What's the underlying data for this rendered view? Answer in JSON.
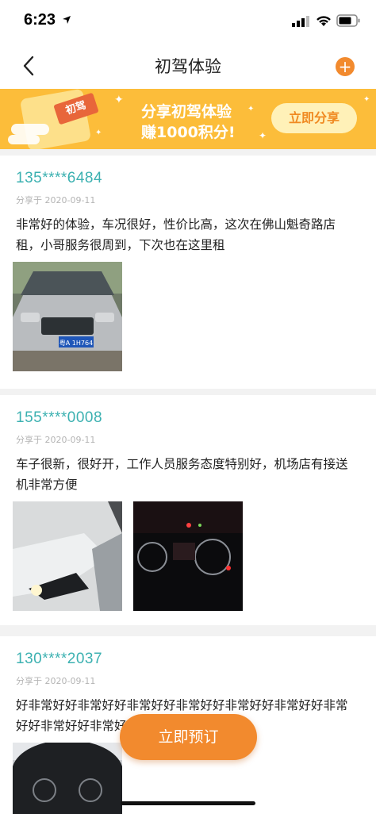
{
  "status": {
    "time": "6:23"
  },
  "nav": {
    "title": "初驾体验",
    "back_icon": "chevron-left-icon",
    "add_icon": "plus-circle-icon"
  },
  "banner": {
    "badge": "初驾",
    "line1": "分享初驾体验",
    "line2": "赚1000积分!",
    "button": "立即分享"
  },
  "reviews": [
    {
      "phone": "135****6484",
      "date": "分享于 2020-09-11",
      "text": "非常好的体验，车况很好，性价比高，这次在佛山魁奇路店租，小哥服务很周到，下次也在这里租",
      "photos": [
        "silver-car-front-photo"
      ]
    },
    {
      "phone": "155****0008",
      "date": "分享于 2020-09-11",
      "text": "车子很新，很好开，工作人员服务态度特别好，机场店有接送机非常方便",
      "photos": [
        "car-headlight-photo",
        "dashboard-night-photo"
      ]
    },
    {
      "phone": "130****2037",
      "date": "分享于 2020-09-11",
      "text": "好非常好好非常好好非常好好非常好好非常好好非常好好非常好好非常好好非常好",
      "photos": [
        "steering-wheel-photo"
      ]
    }
  ],
  "cta": {
    "label": "立即预订"
  },
  "colors": {
    "accent": "#f28a2e",
    "phone": "#3cb1b1",
    "banner": "#fcbd3a"
  }
}
